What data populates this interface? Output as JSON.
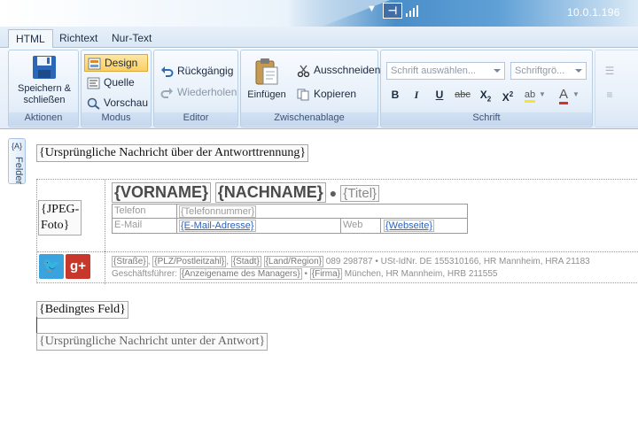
{
  "titlebar": {
    "ip": "10.0.1.196"
  },
  "tabs": [
    {
      "label": "HTML",
      "active": true
    },
    {
      "label": "Richtext",
      "active": false
    },
    {
      "label": "Nur-Text",
      "active": false
    }
  ],
  "ribbon": {
    "aktionen": {
      "label": "Aktionen",
      "save": "Speichern &",
      "save2": "schließen"
    },
    "modus": {
      "label": "Modus",
      "design": "Design",
      "quelle": "Quelle",
      "vorschau": "Vorschau"
    },
    "editor": {
      "label": "Editor",
      "undo": "Rückgängig",
      "redo": "Wiederholen"
    },
    "zwischenablage": {
      "label": "Zwischenablage",
      "paste": "Einfügen",
      "cut": "Ausschneiden",
      "copy": "Kopieren"
    },
    "schrift": {
      "label": "Schrift",
      "font_placeholder": "Schrift auswählen...",
      "size_placeholder": "Schriftgrö..."
    }
  },
  "side_tab": {
    "label": "Felder",
    "icon": "{A}"
  },
  "colors": {
    "accent": "#4a8ec9",
    "twitter": "#3aa2dd",
    "gplus": "#c8372b",
    "link": "#2a62c0"
  },
  "editor": {
    "original_top": "{Ursprüngliche Nachricht über der Antworttrennung}",
    "photo_1": "{JPEG-",
    "photo_2": "Foto}",
    "vorname": "{VORNAME}",
    "nachname": "{NACHNAME}",
    "titel": "{Titel}",
    "telefon_label": "Telefon",
    "telefon_value": "{Telefonnummer}",
    "email_label": "E-Mail",
    "email_value": "{E-Mail-Adresse}",
    "web_label": "Web",
    "web_value": "{Webseite}",
    "address_fields": [
      "{Straße}",
      "{PLZ/Postleitzahl}",
      "{Stadt}",
      "{Land/Region}"
    ],
    "address_rest": "089 298787 • USt-IdNr. DE 155310166, HR Mannheim, HRA 21183",
    "gf_label": "Geschäftsführer:",
    "gf_field": "{Anzeigename des Managers}",
    "firma_field": "{Firma}",
    "firma_rest": "München, HR Mannheim, HRB 211555",
    "conditional": "{Bedingtes Feld}",
    "original_bottom": "{Ursprüngliche Nachricht unter der Antwort}"
  }
}
